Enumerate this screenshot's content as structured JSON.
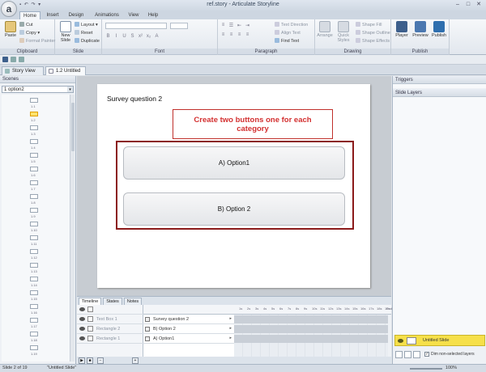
{
  "app": {
    "window_title": "ref.story - Articulate Storyline",
    "logo_glyph": "a",
    "qat_glyphs": "▪ ↶ ↷ ▾"
  },
  "ribbon_tabs": [
    {
      "label": "Home",
      "active": true
    },
    {
      "label": "Insert",
      "active": false
    },
    {
      "label": "Design",
      "active": false
    },
    {
      "label": "Animations",
      "active": false
    },
    {
      "label": "View",
      "active": false
    },
    {
      "label": "Help",
      "active": false
    }
  ],
  "ribbon": {
    "clipboard": {
      "paste": "Paste",
      "cut": "Cut",
      "copy": "Copy",
      "format_painter": "Format Painter",
      "label": "Clipboard"
    },
    "slide": {
      "new_slide": "New Slide",
      "layout": "Layout",
      "reset": "Reset",
      "duplicate": "Duplicate",
      "label": "Slide"
    },
    "font": {
      "label": "Font"
    },
    "paragraph": {
      "text_direction": "Text Direction",
      "align_text": "Align Text",
      "find_text": "Find Text",
      "label": "Paragraph"
    },
    "drawing": {
      "arrange": "Arrange",
      "quick_styles": "Quick Styles",
      "shape_fill": "Shape Fill",
      "shape_outline": "Shape Outline",
      "shape_effects": "Shape Effects",
      "label": "Drawing"
    },
    "publish": {
      "player": "Player",
      "preview": "Preview",
      "publish": "Publish",
      "label": "Publish"
    }
  },
  "doc_tabs": [
    {
      "label": "Story View",
      "active": false
    },
    {
      "label": "1.2 Untitled Slide",
      "active": true
    }
  ],
  "scenes": {
    "title": "Scenes",
    "selected_scene": "1 option2",
    "thumbnails": [
      "1.1",
      "1.2",
      "1.3",
      "1.4",
      "1.5",
      "1.6",
      "1.7",
      "1.8",
      "1.9",
      "1.10",
      "1.11",
      "1.12",
      "1.13",
      "1.14",
      "1.15",
      "1.16",
      "1.17",
      "1.18",
      "1.19"
    ],
    "selected_index": 1
  },
  "slide": {
    "title": "Survey question 2",
    "callout": "Create two buttons one for each category",
    "option_a": "A) Option1",
    "option_b": "B) Option 2"
  },
  "right_panel": {
    "triggers_title": "Triggers",
    "layers_title": "Slide Layers",
    "base_layer": "Untitled Slide",
    "dim_label": "Dim non-selected layers",
    "dim_checked": true
  },
  "timeline": {
    "tabs": [
      {
        "label": "Timeline",
        "active": true
      },
      {
        "label": "States",
        "active": false
      },
      {
        "label": "Notes",
        "active": false
      }
    ],
    "rows": [
      {
        "name": "Text Box 1",
        "content": "Survey question 2"
      },
      {
        "name": "Rectangle 2",
        "content": "B) Option 2"
      },
      {
        "name": "Rectangle 1",
        "content": "A) Option1"
      }
    ],
    "ruler_ticks": [
      "1s",
      "2s",
      "3s",
      "4s",
      "5s",
      "6s",
      "7s",
      "8s",
      "9s",
      "10s",
      "11s",
      "12s",
      "13s",
      "14s",
      "15s",
      "16s",
      "17s",
      "18s",
      "19s"
    ],
    "end_label": "End"
  },
  "status": {
    "slide_count": "Slide 2 of 19",
    "slide_name": "\"Untitled Slide\"",
    "zoom": "100%"
  }
}
